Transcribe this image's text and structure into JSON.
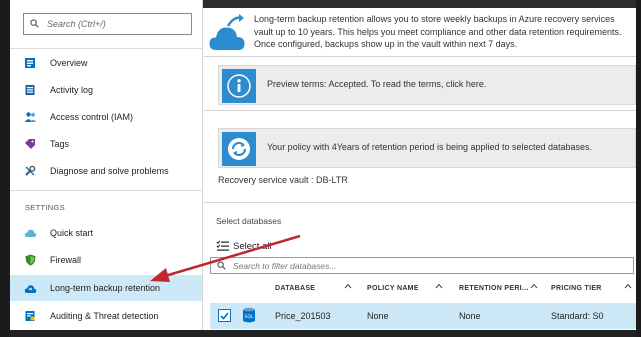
{
  "sidebar": {
    "search_placeholder": "Search (Ctrl+/)",
    "items_top": [
      {
        "label": "Overview",
        "icon": "overview-icon"
      },
      {
        "label": "Activity log",
        "icon": "activity-log-icon"
      },
      {
        "label": "Access control (IAM)",
        "icon": "people-icon"
      },
      {
        "label": "Tags",
        "icon": "tag-icon"
      },
      {
        "label": "Diagnose and solve problems",
        "icon": "wrench-icon"
      }
    ],
    "section_settings": "SETTINGS",
    "items_settings": [
      {
        "label": "Quick start",
        "icon": "cloud-icon"
      },
      {
        "label": "Firewall",
        "icon": "shield-icon"
      },
      {
        "label": "Long-term backup retention",
        "icon": "backup-cloud-icon",
        "active": true
      },
      {
        "label": "Auditing & Threat detection",
        "icon": "auditing-icon"
      }
    ]
  },
  "main": {
    "intro_text": "Long-term backup retention allows you to store weekly backups in Azure recovery services vault up to 10 years. This helps you meet compliance and other data retention requirements. Once configured, backups show up in the vault within next 7 days.",
    "preview_banner": "Preview terms: Accepted. To read the terms, click here.",
    "policy_banner": "Your policy with 4Years of retention period is being applied to selected databases.",
    "vault_label": "Recovery service vault : DB-LTR",
    "select_databases_label": "Select databases",
    "select_all_label": "Select all",
    "filter_placeholder": "Search to filter databases...",
    "table": {
      "columns": [
        "DATABASE",
        "POLICY NAME",
        "RETENTION PERI...",
        "PRICING TIER"
      ],
      "rows": [
        {
          "checked": true,
          "database": "Price_201503",
          "policy_name": "None",
          "retention": "None",
          "pricing_tier": "Standard: S0"
        }
      ]
    }
  },
  "colors": {
    "accent": "#2d8ccf",
    "active_bg": "#cde8f7",
    "arrow": "#c0282d",
    "banner_bg": "#ececec"
  }
}
